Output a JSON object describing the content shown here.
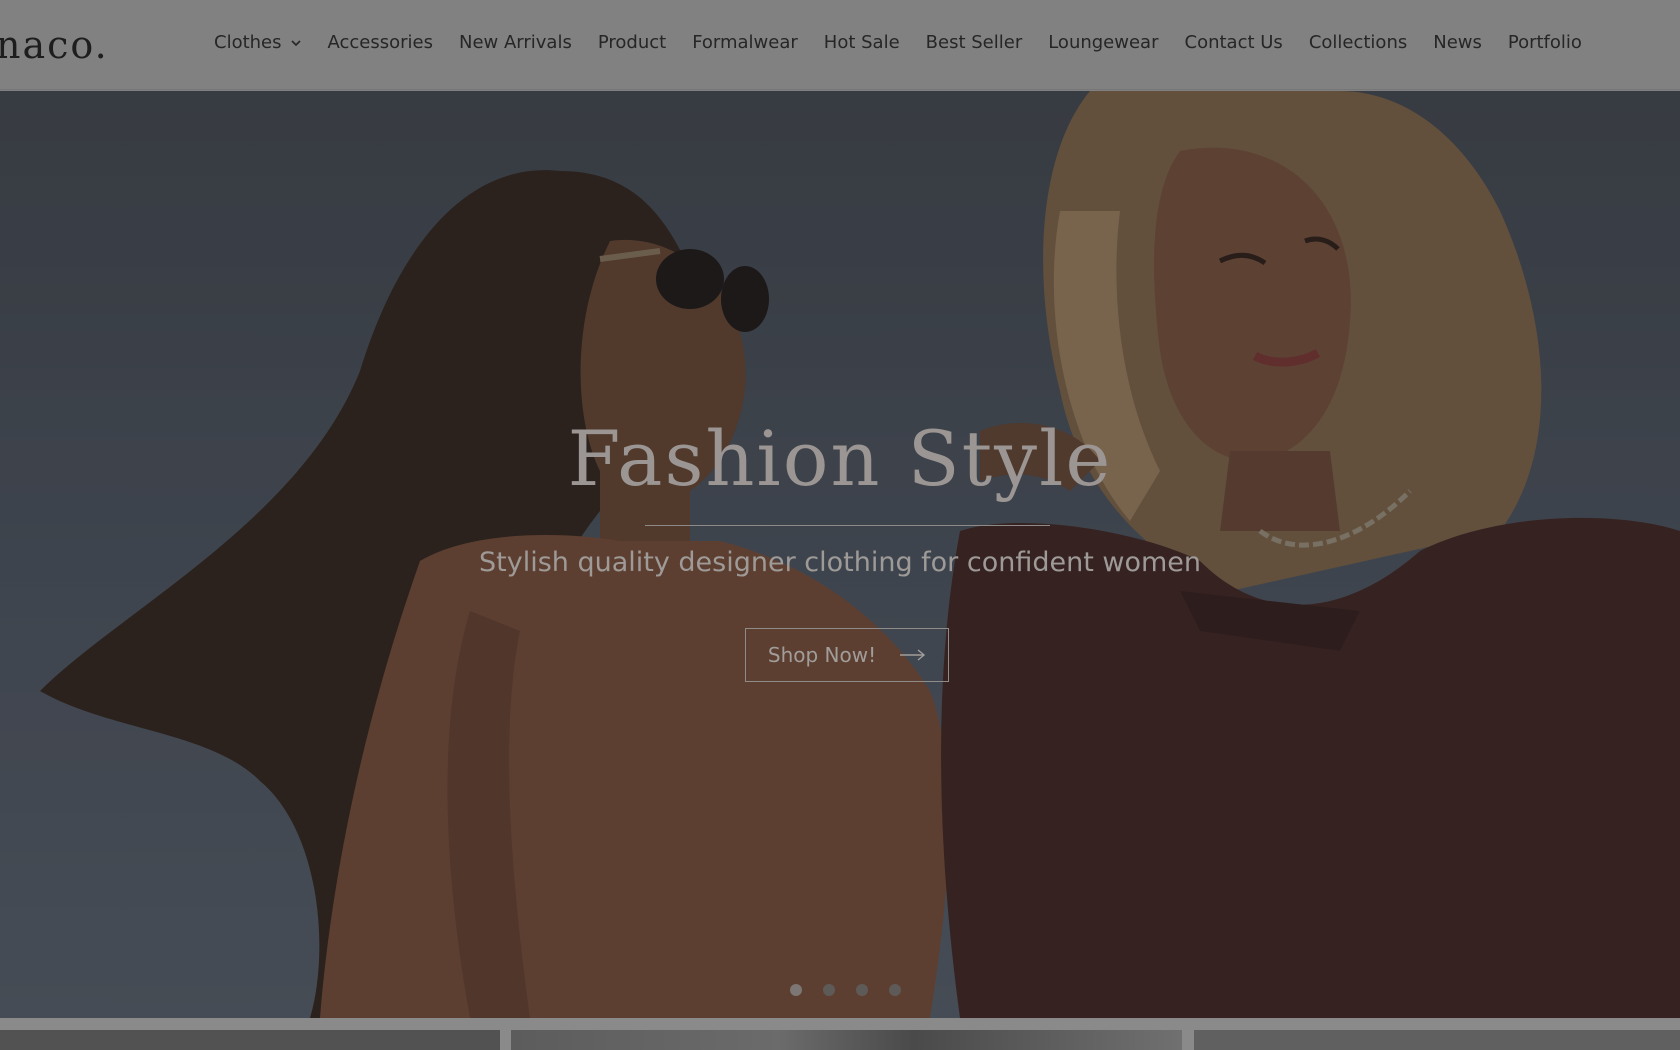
{
  "header": {
    "logo": "naco.",
    "nav": [
      {
        "label": "Clothes",
        "has_dropdown": true
      },
      {
        "label": "Accessories"
      },
      {
        "label": "New Arrivals"
      },
      {
        "label": "Product"
      },
      {
        "label": "Formalwear"
      },
      {
        "label": "Hot Sale"
      },
      {
        "label": "Best Seller"
      },
      {
        "label": "Loungewear"
      },
      {
        "label": "Contact Us"
      },
      {
        "label": "Collections"
      },
      {
        "label": "News"
      },
      {
        "label": "Portfolio"
      }
    ]
  },
  "hero": {
    "title": "Fashion Style",
    "subtitle": "Stylish quality designer clothing for confident women",
    "cta_label": "Shop Now!",
    "slides_count": 4,
    "active_slide": 1
  },
  "icons": {
    "dropdown": "chevron-down-icon",
    "cta_arrow": "arrow-right-icon"
  },
  "colors": {
    "header_bg": "#818181",
    "text_dark": "#262626",
    "hero_title": "#9b9693"
  }
}
